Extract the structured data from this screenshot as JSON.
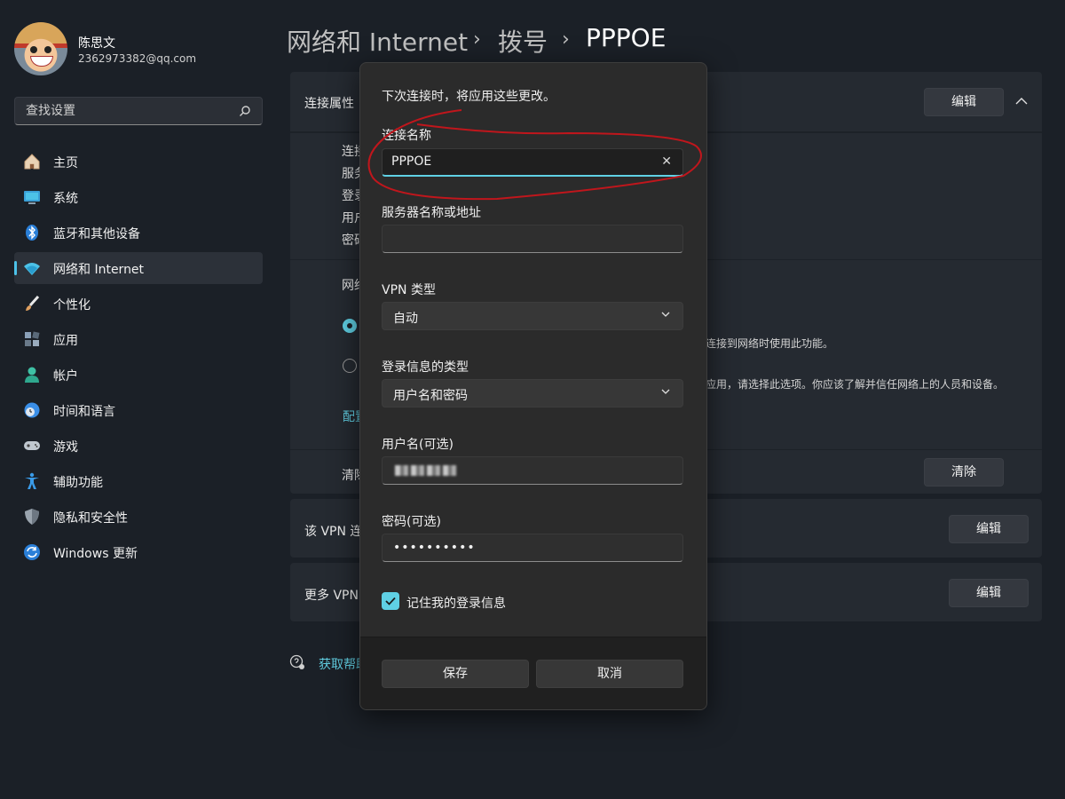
{
  "user": {
    "name": "陈思文",
    "email": "2362973382@qq.com"
  },
  "search": {
    "placeholder": "查找设置",
    "icon": "search-icon"
  },
  "sidebar": {
    "items": [
      {
        "label": "主页",
        "icon": "home-icon",
        "color": "#e8e8e8"
      },
      {
        "label": "系统",
        "icon": "display-icon",
        "color": "#4cc2e8"
      },
      {
        "label": "蓝牙和其他设备",
        "icon": "bluetooth-icon",
        "color": "#3a8ee6"
      },
      {
        "label": "网络和 Internet",
        "icon": "wifi-icon",
        "color": "#4cc2e8",
        "active": true
      },
      {
        "label": "个性化",
        "icon": "brush-icon",
        "color": "#e0a060"
      },
      {
        "label": "应用",
        "icon": "apps-icon",
        "color": "#8aa0b8"
      },
      {
        "label": "帐户",
        "icon": "person-icon",
        "color": "#3fc1a5"
      },
      {
        "label": "时间和语言",
        "icon": "clock-globe-icon",
        "color": "#4ca3e8"
      },
      {
        "label": "游戏",
        "icon": "gamepad-icon",
        "color": "#c0c8d0"
      },
      {
        "label": "辅助功能",
        "icon": "accessibility-icon",
        "color": "#3a9be8"
      },
      {
        "label": "隐私和安全性",
        "icon": "shield-icon",
        "color": "#9aa4ae"
      },
      {
        "label": "Windows 更新",
        "icon": "update-icon",
        "color": "#3a9be8"
      }
    ]
  },
  "breadcrumb": {
    "parts": [
      "网络和 Internet",
      "拨号",
      "PPPOE"
    ]
  },
  "background": {
    "conn_props_label": "连接属性",
    "edit_label": "编辑",
    "prop_labels": [
      "连接",
      "服务",
      "登录",
      "用户",
      "密码"
    ],
    "network_label": "网络",
    "radio1_desc": "连接到网络时使用此功能。",
    "radio2_desc": "应用，请选择此选项。你应该了解并信任网络上的人员和设备。",
    "configure_link": "配置",
    "clear_row_label": "清除",
    "clear_button": "清除",
    "vpn_row_label": "该 VPN 连",
    "more_vpn_label": "更多 VPN",
    "help_link": "获取帮助"
  },
  "dialog": {
    "header": "下次连接时，将应用这些更改。",
    "conn_name": {
      "label": "连接名称",
      "value": "PPPOE"
    },
    "server": {
      "label": "服务器名称或地址",
      "value": ""
    },
    "vpn_type": {
      "label": "VPN 类型",
      "value": "自动"
    },
    "signin_type": {
      "label": "登录信息的类型",
      "value": "用户名和密码"
    },
    "username": {
      "label": "用户名(可选)"
    },
    "password": {
      "label": "密码(可选)",
      "value": "••••••••••"
    },
    "remember": {
      "label": "记住我的登录信息",
      "checked": true
    },
    "save": "保存",
    "cancel": "取消"
  },
  "colors": {
    "accent": "#5fd0e4",
    "annotation": "#c0161c",
    "background": "#1b2027"
  }
}
